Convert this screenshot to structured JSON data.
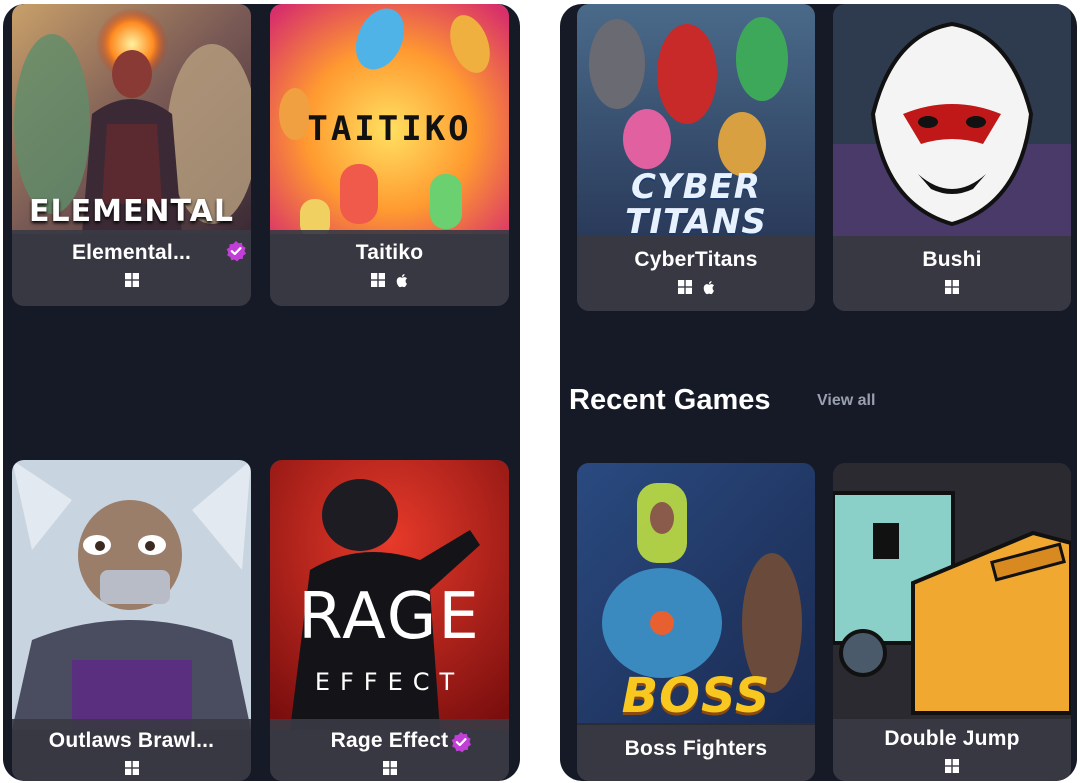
{
  "colors": {
    "panel_bg": "#161a26",
    "card_info_bg": "#3a3a44",
    "verified_badge": "#c13fd6",
    "text_primary": "#ffffff",
    "text_muted": "#9aa0b0"
  },
  "left_panel": {
    "cards": [
      {
        "name": "Elemental...",
        "art_text": "ELEMENTAL",
        "platforms": [
          "windows-icon"
        ],
        "verified": true
      },
      {
        "name": "Taitiko",
        "art_text": "TAITIKO",
        "platforms": [
          "windows-icon",
          "apple-icon"
        ],
        "verified": false
      },
      {
        "name": "Outlaws Brawl...",
        "art_text": "",
        "platforms": [
          "windows-icon"
        ],
        "verified": false
      },
      {
        "name": "Rage Effect",
        "art_text": "RAGE",
        "art_subtext": "EFFECT",
        "platforms": [
          "windows-icon"
        ],
        "verified": true
      }
    ]
  },
  "right_panel": {
    "cards": [
      {
        "name": "CyberTitans",
        "art_text": "CYBER",
        "art_subtext": "TITANS",
        "platforms": [
          "windows-icon",
          "apple-icon"
        ],
        "verified": false
      },
      {
        "name": "Bushi",
        "art_text": "",
        "platforms": [
          "windows-icon"
        ],
        "verified": false
      }
    ],
    "recent_section": {
      "title": "Recent Games",
      "view_all": "View all",
      "cards": [
        {
          "name": "Boss Fighters",
          "art_text": "BOSS",
          "platforms": [],
          "verified": false
        },
        {
          "name": "Double Jump",
          "art_text": "",
          "platforms": [
            "windows-icon"
          ],
          "verified": false
        }
      ]
    }
  }
}
